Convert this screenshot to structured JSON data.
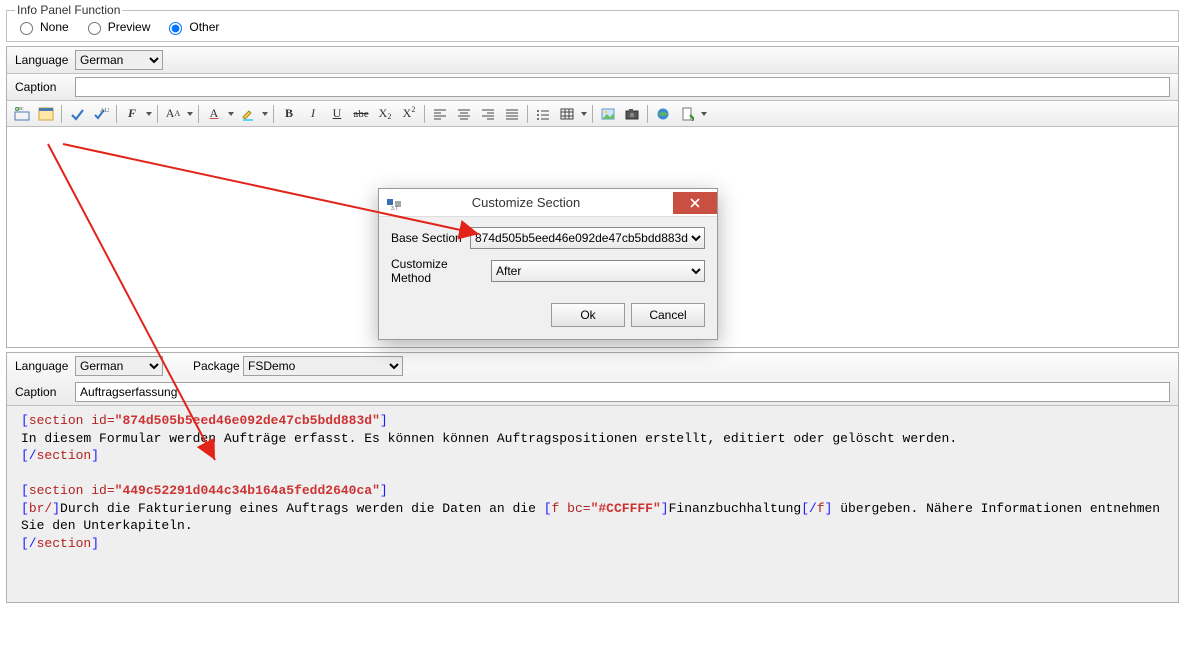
{
  "infoPanel": {
    "legend": "Info Panel Function",
    "options": {
      "none": "None",
      "preview": "Preview",
      "other": "Other"
    }
  },
  "top": {
    "languageLabel": "Language",
    "languageValue": "German",
    "captionLabel": "Caption",
    "captionValue": ""
  },
  "dialog": {
    "title": "Customize Section",
    "baseSectionLabel": "Base Section",
    "baseSectionValue": "874d505b5eed46e092de47cb5bdd883d",
    "methodLabel": "Customize Method",
    "methodValue": "After",
    "ok": "Ok",
    "cancel": "Cancel"
  },
  "bottom": {
    "languageLabel": "Language",
    "languageValue": "German",
    "packageLabel": "Package",
    "packageValue": "FSDemo",
    "captionLabel": "Caption",
    "captionValue": "Auftragserfassung"
  },
  "code": {
    "s1_open_a": "[",
    "s1_open_b": "section",
    "s1_open_c": " id=",
    "s1_open_d": "\"874d505b5eed46e092de47cb5bdd883d\"",
    "s1_open_e": "]",
    "s1_body": "In diesem Formular werden Aufträge erfasst. Es können können Auftragspositionen erstellt, editiert oder gelöscht werden.",
    "s1_close_a": "[/",
    "s1_close_b": "section",
    "s1_close_c": "]",
    "s2_open_a": "[",
    "s2_open_b": "section",
    "s2_open_c": " id=",
    "s2_open_d": "\"449c52291d044c34b164a5fedd2640ca\"",
    "s2_open_e": "]",
    "s2_br_a": "[",
    "s2_br_b": "br/",
    "s2_br_c": "]",
    "s2_t1": "Durch die Fakturierung eines Auftrags werden die Daten an die ",
    "s2_f_a": "[",
    "s2_f_b": "f",
    "s2_f_c": " bc=",
    "s2_f_d": "\"#CCFFFF\"",
    "s2_f_e": "]",
    "s2_f_body": "Finanzbuchhaltung",
    "s2_f_close_a": "[/",
    "s2_f_close_b": "f",
    "s2_f_close_c": "]",
    "s2_t2": " übergeben. Nähere Informationen entnehmen Sie den Unterkapiteln.",
    "s2_close_a": "[/",
    "s2_close_b": "section",
    "s2_close_c": "]"
  }
}
